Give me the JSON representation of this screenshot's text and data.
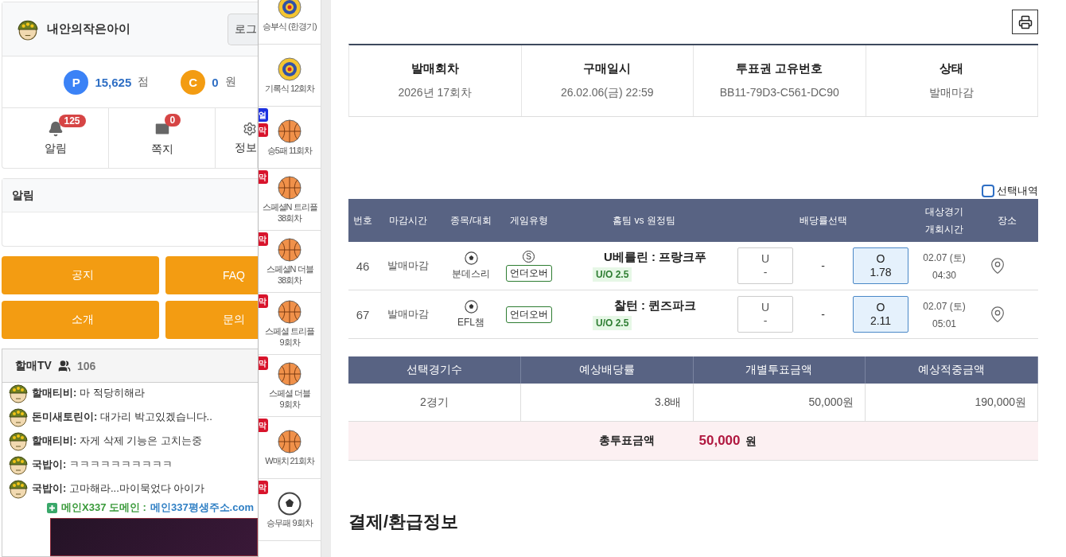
{
  "user": {
    "name": "내안의작은아이",
    "login_button": "로그"
  },
  "points": [
    {
      "kind": "point",
      "icon": "P",
      "value": "15,625",
      "unit": "점"
    },
    {
      "kind": "cash",
      "icon": "C",
      "value": "0",
      "unit": "원"
    }
  ],
  "shortcuts": [
    {
      "kind": "bell",
      "label": "알림",
      "badge": "125"
    },
    {
      "kind": "mail",
      "label": "쪽지",
      "badge": "0"
    },
    {
      "kind": "gear",
      "label": "정보"
    }
  ],
  "notice_box": {
    "title": "알림"
  },
  "menu_buttons": [
    "공지",
    "FAQ",
    "소개",
    "문의"
  ],
  "chat": {
    "title": "할매TV",
    "viewers": "106",
    "messages": [
      {
        "user": "할매티비:",
        "text": "마 적당히해라"
      },
      {
        "user": "돈미새토린이:",
        "text": "대가리 박고있겠습니다.."
      },
      {
        "user": "할매티비:",
        "text": "자게 삭제 기능은 고치는중"
      },
      {
        "user": "국밥이:",
        "text": "ㅋㅋㅋㅋㅋㅋㅋㅋㅋㅋ"
      },
      {
        "user": "국밥이:",
        "text": "고마해라...마이묵었다 아이가"
      }
    ],
    "promo": {
      "label": "메인X337 도메인 :",
      "link": "메인337평생주소.com"
    }
  },
  "game_strip": [
    {
      "kind": "target",
      "label": "승부식 (한경기)"
    },
    {
      "kind": "target",
      "label": "기록식 12회차"
    },
    {
      "kind": "basketball",
      "label": "승5패 11회차",
      "badges": [
        {
          "text": "얼",
          "color": "#1b2fe0"
        },
        {
          "text": "막",
          "color": "#d8142c"
        }
      ]
    },
    {
      "kind": "basketball",
      "label": "스페셜N 트리플 38회차",
      "badges": [
        {
          "text": "막",
          "color": "#d8142c"
        }
      ]
    },
    {
      "kind": "basketball",
      "label": "스페셜N 더블 38회차",
      "badges": [
        {
          "text": "막",
          "color": "#d8142c"
        }
      ]
    },
    {
      "kind": "basketball",
      "label": "스페셜 트리플 9회차",
      "badges": [
        {
          "text": "막",
          "color": "#d8142c"
        }
      ]
    },
    {
      "kind": "basketball",
      "label": "스페셜 더블 9회차",
      "badges": [
        {
          "text": "막",
          "color": "#d8142c"
        }
      ]
    },
    {
      "kind": "basketball",
      "label": "W매치 21회차",
      "badges": [
        {
          "text": "막",
          "color": "#d8142c"
        }
      ]
    },
    {
      "kind": "soccer",
      "label": "승무패 9회차",
      "badges": [
        {
          "text": "막",
          "color": "#d8142c"
        }
      ]
    }
  ],
  "purchase_info": [
    {
      "label": "발매회차",
      "value": "2026년 17회차"
    },
    {
      "label": "구매일시",
      "value": "26.02.06(금) 22:59"
    },
    {
      "label": "투표권 고유번호",
      "value": "BB11-79D3-C561-DC90"
    },
    {
      "label": "상태",
      "value": "발매마감"
    }
  ],
  "selection_toggle": {
    "label": "선택내역",
    "checked": false
  },
  "bets": {
    "columns": [
      "번호",
      "마감시간",
      "종목/대회",
      "게임유형",
      "홈팀 vs 원정팀",
      "배당률선택",
      "대상경기 개회시간",
      "장소"
    ],
    "rows": [
      {
        "no": "46",
        "deadline": "발매마감",
        "league": "분데스리",
        "special_mark": "S",
        "game_type": "언더오버",
        "match": "U베를린 : 프랑크푸",
        "handicap": "U/O 2.5",
        "under": {
          "label": "U",
          "odds": "-",
          "selected": false
        },
        "draw": "-",
        "over": {
          "label": "O",
          "odds": "1.78",
          "selected": true
        },
        "date": "02.07 (토)",
        "time": "04:30"
      },
      {
        "no": "67",
        "deadline": "발매마감",
        "league": "EFL챔",
        "game_type": "언더오버",
        "match": "찰턴 : 퀸즈파크",
        "handicap": "U/O 2.5",
        "under": {
          "label": "U",
          "odds": "-",
          "selected": false
        },
        "draw": "-",
        "over": {
          "label": "O",
          "odds": "2.11",
          "selected": true
        },
        "date": "02.07 (토)",
        "time": "05:01"
      }
    ]
  },
  "summary": {
    "columns": [
      "선택경기수",
      "예상배당률",
      "개별투표금액",
      "예상적중금액"
    ],
    "values": [
      "2경기",
      "3.8배",
      "50,000원",
      "190,000원"
    ]
  },
  "total": {
    "label": "총투표금액",
    "value": "50,000",
    "unit": "원"
  },
  "section_title": "결제/환급정보"
}
